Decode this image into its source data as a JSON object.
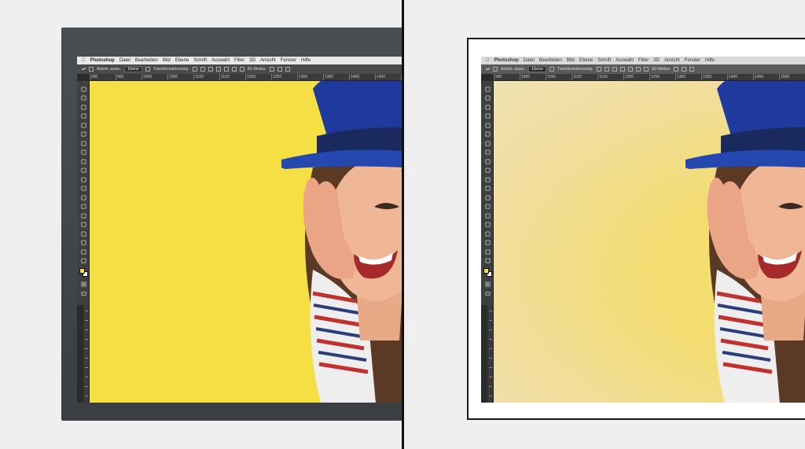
{
  "menubar": {
    "apple": "",
    "app_name": "Photoshop",
    "items": [
      "Datei",
      "Bearbeiten",
      "Bild",
      "Ebene",
      "Schrift",
      "Auswahl",
      "Filter",
      "3D",
      "Ansicht",
      "Fenster",
      "Hilfe"
    ]
  },
  "options_bar": {
    "auto_select_label": "Autom. ausw.:",
    "auto_select_value": "Ebene",
    "transform_label": "Transformationsstrg.",
    "mode_3d_label": "3D-Modus:"
  },
  "ruler_left": [
    "900",
    "950",
    "1000",
    "1050",
    "1100",
    "1150",
    "1200",
    "1250",
    "1300",
    "1350",
    "1400",
    "1450",
    "1500",
    "1550",
    "1600",
    "1650",
    "1700",
    "1750"
  ],
  "ruler_right": [
    "900",
    "1000",
    "1050",
    "1100",
    "1150",
    "1200",
    "1250",
    "1300",
    "1350",
    "1400",
    "1450",
    "1500",
    "1550",
    "1600",
    "1650",
    "1700",
    "1750",
    "1800"
  ],
  "colors": {
    "canvas_yellow": "#f5df45",
    "hat_blue": "#1f3a9e",
    "foreground_swatch": "#f5dd43",
    "background_swatch": "#ffffff"
  },
  "tools": [
    "move-tool",
    "marquee-tool",
    "lasso-tool",
    "quick-select-tool",
    "crop-tool",
    "eyedropper-tool",
    "healing-tool",
    "brush-tool",
    "stamp-tool",
    "history-brush-tool",
    "eraser-tool",
    "gradient-tool",
    "blur-tool",
    "dodge-tool",
    "pen-tool",
    "type-tool",
    "path-select-tool",
    "shape-tool",
    "hand-tool",
    "zoom-tool"
  ]
}
